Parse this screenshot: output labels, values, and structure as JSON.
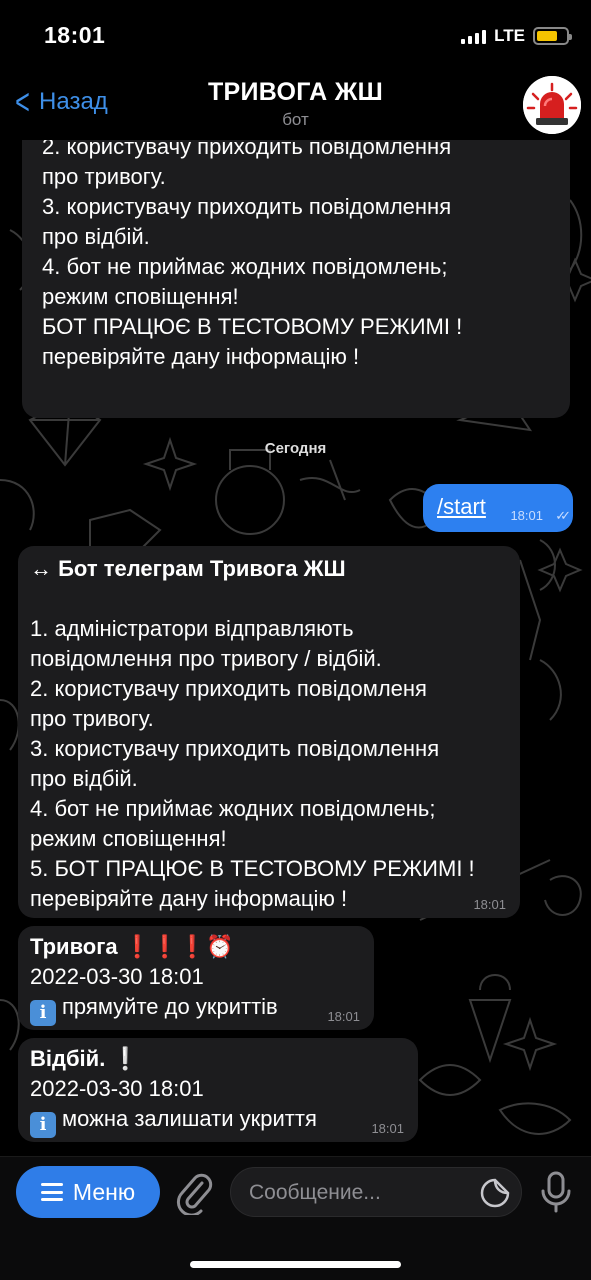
{
  "status_bar": {
    "time": "18:01",
    "network": "LTE"
  },
  "header": {
    "back_label": "Назад",
    "title": "ТРИВОГА ЖШ",
    "subtitle": "бот",
    "avatar_icon": "siren-icon"
  },
  "chat": {
    "previous_message": {
      "lines": [
        "2. користувачу приходить повідомлення",
        "про тривогу.",
        "3. користувачу приходить повідомлення",
        "про відбій.",
        "4. бот не приймає жодних повідомлень;",
        "режим сповіщення!",
        "БОТ ПРАЦЮЄ В ТЕСТОВОМУ РЕЖИМІ !",
        "перевіряйте дану інформацію !"
      ]
    },
    "date_separator": "Сегодня",
    "outgoing": {
      "text": "/start",
      "time": "18:01",
      "status": "read"
    },
    "bot_intro": {
      "heading": "↔ Бот телеграм Тривога ЖШ",
      "lines": [
        "1. адміністратори відправляють",
        "повідомлення про тривогу / відбій.",
        "2. користувачу приходить повідомленя",
        "про тривогу.",
        "3. користувачу приходить повідомлення",
        "про відбій.",
        "4. бот не приймає жодних повідомлень;",
        "режим сповіщення!",
        "5. БОТ ПРАЦЮЄ В ТЕСТОВОМУ РЕЖИМІ !",
        "перевіряйте дану інформацію !"
      ],
      "time": "18:01"
    },
    "alarm_message": {
      "title": "Тривога",
      "emphasis": "❗❗❗⏰",
      "datetime": "2022-03-30 18:01",
      "info": "прямуйте до укриттів",
      "time": "18:01"
    },
    "clear_message": {
      "title": "Відбій.",
      "emphasis": "❕",
      "datetime": "2022-03-30 18:01",
      "info": "можна залишати укриття",
      "time": "18:01"
    }
  },
  "composer": {
    "menu_label": "Меню",
    "placeholder": "Сообщение..."
  },
  "colors": {
    "accent": "#2f7de8",
    "bubble": "#1c1c1e",
    "outgoing": "#2d80f0"
  }
}
